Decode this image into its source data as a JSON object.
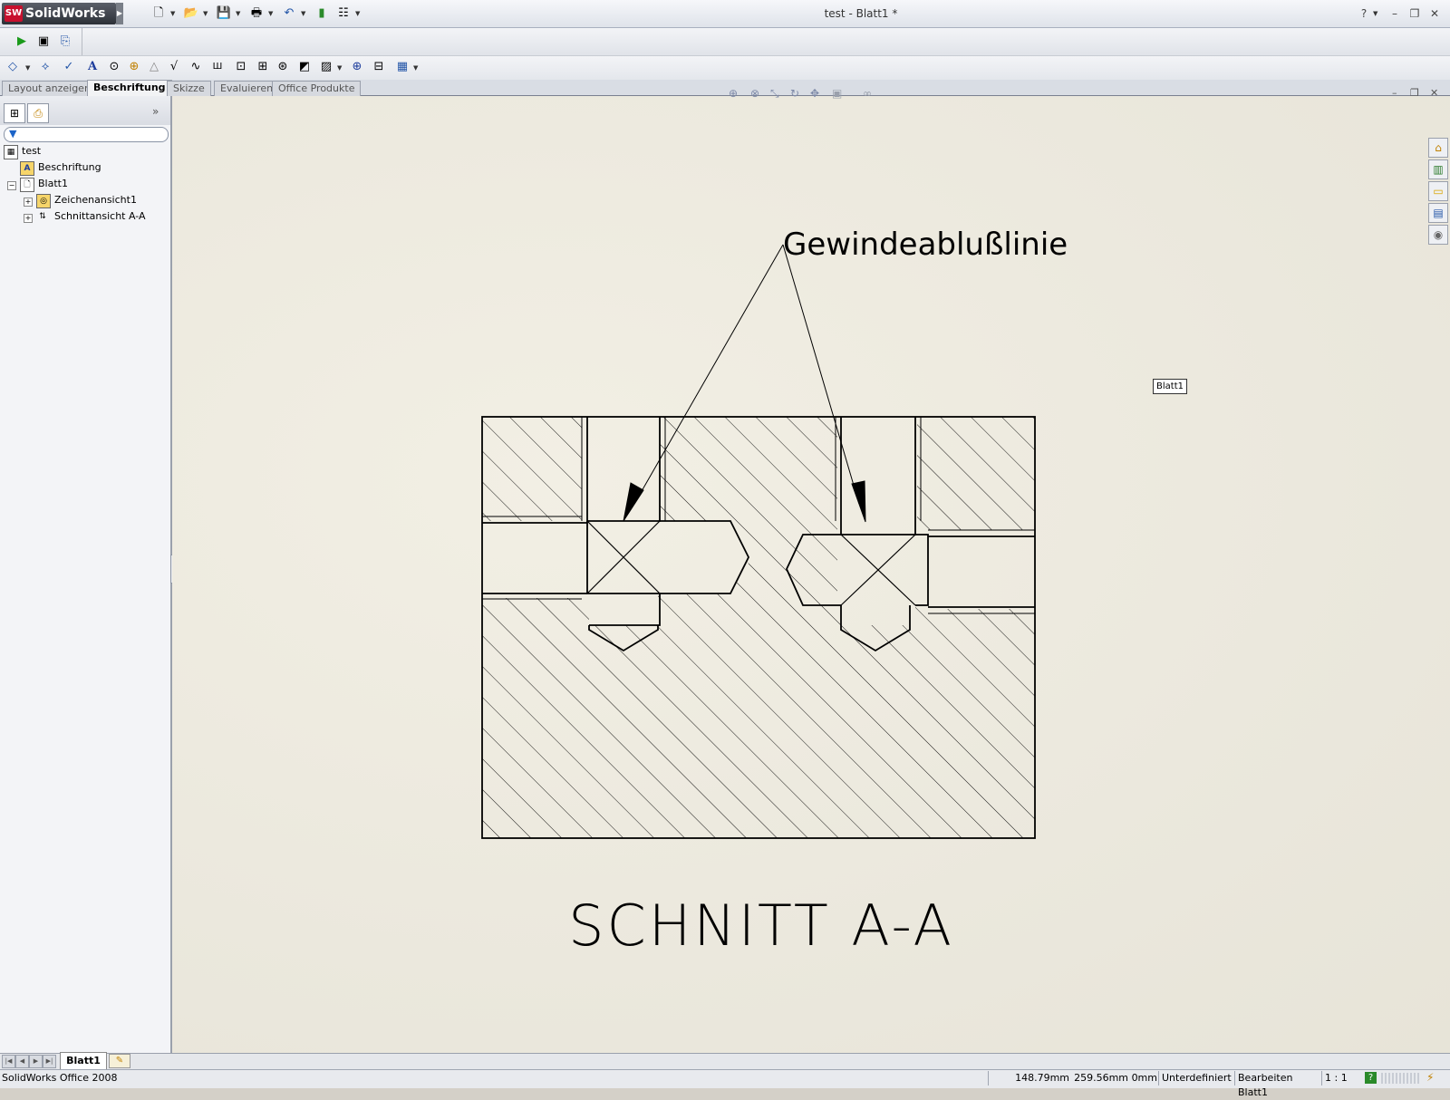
{
  "app": {
    "name": "SolidWorks",
    "logo_mark": "SW",
    "document_title": "test - Blatt1 *"
  },
  "window_controls": {
    "help": "?",
    "minimize": "–",
    "restore": "❐",
    "close": "✕"
  },
  "tabs": [
    {
      "label": "Layout anzeigen",
      "active": false
    },
    {
      "label": "Beschriftung",
      "active": true
    },
    {
      "label": "Skizze",
      "active": false
    },
    {
      "label": "Evaluieren",
      "active": false
    },
    {
      "label": "Office Produkte",
      "active": false
    }
  ],
  "feature_tree": {
    "root": "test",
    "items": [
      {
        "label": "Beschriftung",
        "icon": "annotation-icon"
      },
      {
        "label": "Blatt1",
        "icon": "sheet-icon"
      },
      {
        "label": "Zeichenansicht1",
        "icon": "drawing-view-icon"
      },
      {
        "label": "Schnittansicht A-A",
        "icon": "section-view-icon"
      }
    ]
  },
  "drawing": {
    "note": "Gewindeablußlinie",
    "view_label": "SCHNITT A-A",
    "sheet_label": "Blatt1"
  },
  "sheet_tab": "Blatt1",
  "status": {
    "product": "SolidWorks Office 2008",
    "x": "148.79mm",
    "y": "259.56mm",
    "z": "0mm",
    "definition": "Unterdefiniert",
    "mode": "Bearbeiten Blatt1",
    "scale": "1 : 1",
    "help": "?"
  },
  "colors": {
    "brand_red": "#c8102e",
    "sheet_background": "#ebe8dd",
    "ui_chrome": "#e0e3e9"
  }
}
